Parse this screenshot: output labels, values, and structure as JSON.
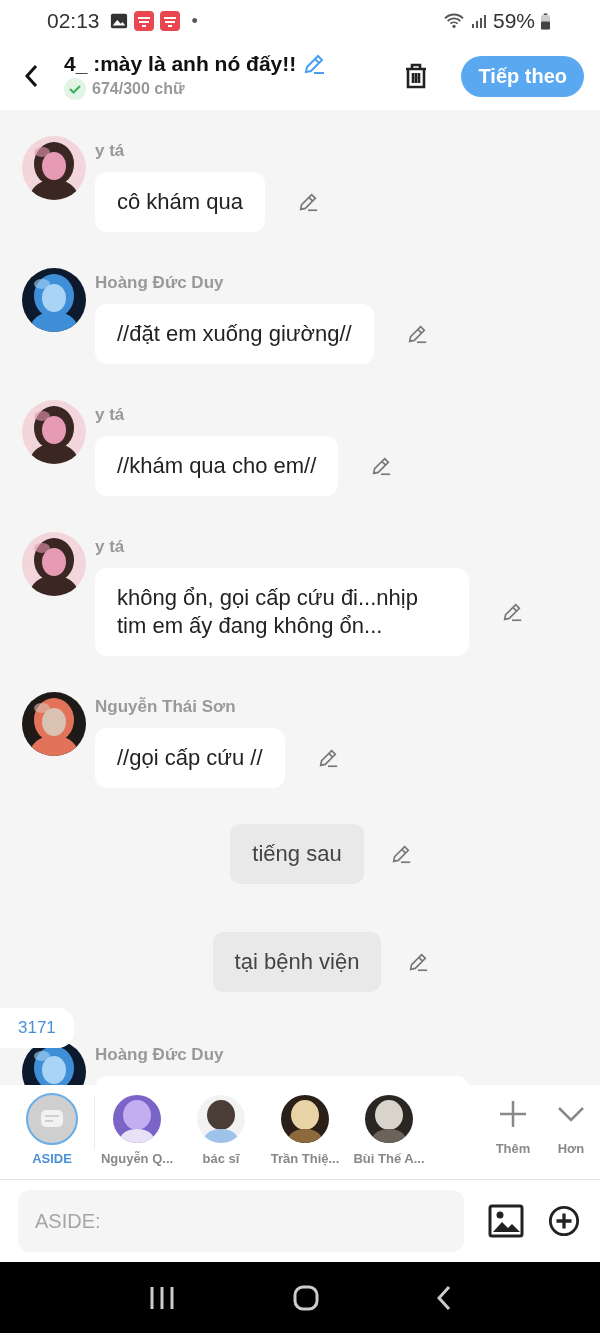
{
  "status_bar": {
    "time": "02:13",
    "dot": "•",
    "battery_text": "59%"
  },
  "header": {
    "title": "4_ :mày là anh nó đấy!!",
    "word_count": "674/300 chữ",
    "next_button": "Tiếp theo"
  },
  "messages": [
    {
      "kind": "character",
      "name": "y tá",
      "text": "cô khám qua"
    },
    {
      "kind": "character",
      "name": "Hoàng Đức Duy",
      "text": "//đặt em xuống giường//"
    },
    {
      "kind": "character",
      "name": "y tá",
      "text": "//khám qua cho em//"
    },
    {
      "kind": "character",
      "name": "y tá",
      "text": "không ổn, gọi cấp cứu đi...nhịp tim em ấy đang không ổn..."
    },
    {
      "kind": "character",
      "name": "Nguyễn Thái Sơn",
      "text": "//gọi cấp cứu //"
    },
    {
      "kind": "aside",
      "text": "tiếng sau"
    },
    {
      "kind": "aside",
      "text": "tại bệnh viện"
    },
    {
      "kind": "character",
      "name": "Hoàng Đức Duy"
    }
  ],
  "counter_badge": "3171",
  "characters": [
    {
      "kind": "aside",
      "name": "ASIDE",
      "selected": true
    },
    {
      "kind": "person",
      "name": "Nguyễn Q...",
      "selected": false
    },
    {
      "kind": "person",
      "name": "bác sĩ",
      "selected": false
    },
    {
      "kind": "person",
      "name": "Trần Thiệ...",
      "selected": false
    },
    {
      "kind": "person",
      "name": "Bùi Thế A...",
      "selected": false
    }
  ],
  "add_label": "Thêm",
  "more_label": "Hơn",
  "input": {
    "placeholder": "ASIDE:"
  }
}
